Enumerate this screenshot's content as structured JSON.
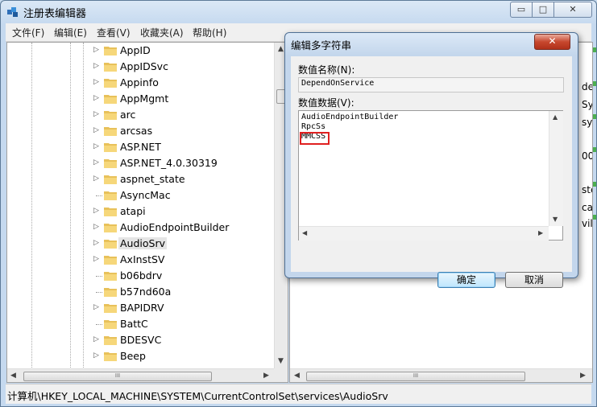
{
  "window": {
    "title": "注册表编辑器",
    "buttons": {
      "minimize": "▭",
      "maximize": "□",
      "close": "✕"
    }
  },
  "menu": [
    "文件(F)",
    "编辑(E)",
    "查看(V)",
    "收藏夹(A)",
    "帮助(H)"
  ],
  "tree": {
    "items": [
      {
        "label": "AppID",
        "expandable": true
      },
      {
        "label": "AppIDSvc",
        "expandable": true
      },
      {
        "label": "Appinfo",
        "expandable": true
      },
      {
        "label": "AppMgmt",
        "expandable": true
      },
      {
        "label": "arc",
        "expandable": true
      },
      {
        "label": "arcsas",
        "expandable": true
      },
      {
        "label": "ASP.NET",
        "expandable": true
      },
      {
        "label": "ASP.NET_4.0.30319",
        "expandable": true
      },
      {
        "label": "aspnet_state",
        "expandable": true
      },
      {
        "label": "AsyncMac",
        "expandable": false
      },
      {
        "label": "atapi",
        "expandable": true
      },
      {
        "label": "AudioEndpointBuilder",
        "expandable": true
      },
      {
        "label": "AudioSrv",
        "expandable": true,
        "selected": true
      },
      {
        "label": "AxInstSV",
        "expandable": true
      },
      {
        "label": "b06bdrv",
        "expandable": false
      },
      {
        "label": "b57nd60a",
        "expandable": false
      },
      {
        "label": "BAPIDRV",
        "expandable": true
      },
      {
        "label": "BattC",
        "expandable": false
      },
      {
        "label": "BDESVC",
        "expandable": true
      },
      {
        "label": "Beep",
        "expandable": true
      }
    ]
  },
  "scroll_thumb_label": "III",
  "right_pane_fragments": [
    "de",
    "Sy:",
    "sys",
    "00",
    "ste",
    "ca",
    "vile"
  ],
  "status": "计算机\\HKEY_LOCAL_MACHINE\\SYSTEM\\CurrentControlSet\\services\\AudioSrv",
  "dialog": {
    "title": "编辑多字符串",
    "close": "✕",
    "name_label": "数值名称(N):",
    "name_value": "DependOnService",
    "data_label": "数值数据(V):",
    "data_lines": [
      "AudioEndpointBuilder",
      "RpcSs",
      "MMCSS"
    ],
    "ok": "确定",
    "cancel": "取消"
  },
  "colors": {
    "highlight_box": "#e02020",
    "selection": "#e5e5e5",
    "accent": "#3c7fb1"
  }
}
